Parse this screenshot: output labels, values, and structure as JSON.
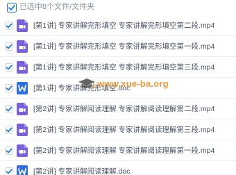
{
  "header": {
    "selection_count": "已选中8个文件/文件夹"
  },
  "files": [
    {
      "name": "[第1讲] 专家讲解完形填空 专家讲解完形填空第二段.mp4",
      "type": "video"
    },
    {
      "name": "[第1讲] 专家讲解完形填空 专家讲解完形填空第一段.mp4",
      "type": "video"
    },
    {
      "name": "[第1讲] 专家讲解完形填空 专家讲解完形填空第三段.mp4",
      "type": "video"
    },
    {
      "name": "[第1讲] 专家讲解完形填空.doc",
      "type": "word"
    },
    {
      "name": "[第2讲] 专家讲解阅读理解 专家讲解阅读理解第二段.mp4",
      "type": "video"
    },
    {
      "name": "[第2讲] 专家讲解阅读理解 专家讲解阅读理解第三段.mp4",
      "type": "video"
    },
    {
      "name": "[第2讲] 专家讲解阅读理解 专家讲解阅读理解第一段.mp4",
      "type": "video"
    },
    {
      "name": "[第2讲] 专家讲解阅读理解.doc",
      "type": "word"
    }
  ],
  "watermark": {
    "text": "www.xue-ba.org"
  },
  "colors": {
    "checkbox": "#1f7ae0",
    "video_icon": "#7b61d9",
    "word_icon": "#2f6fe0",
    "watermark": "#e8891a"
  }
}
